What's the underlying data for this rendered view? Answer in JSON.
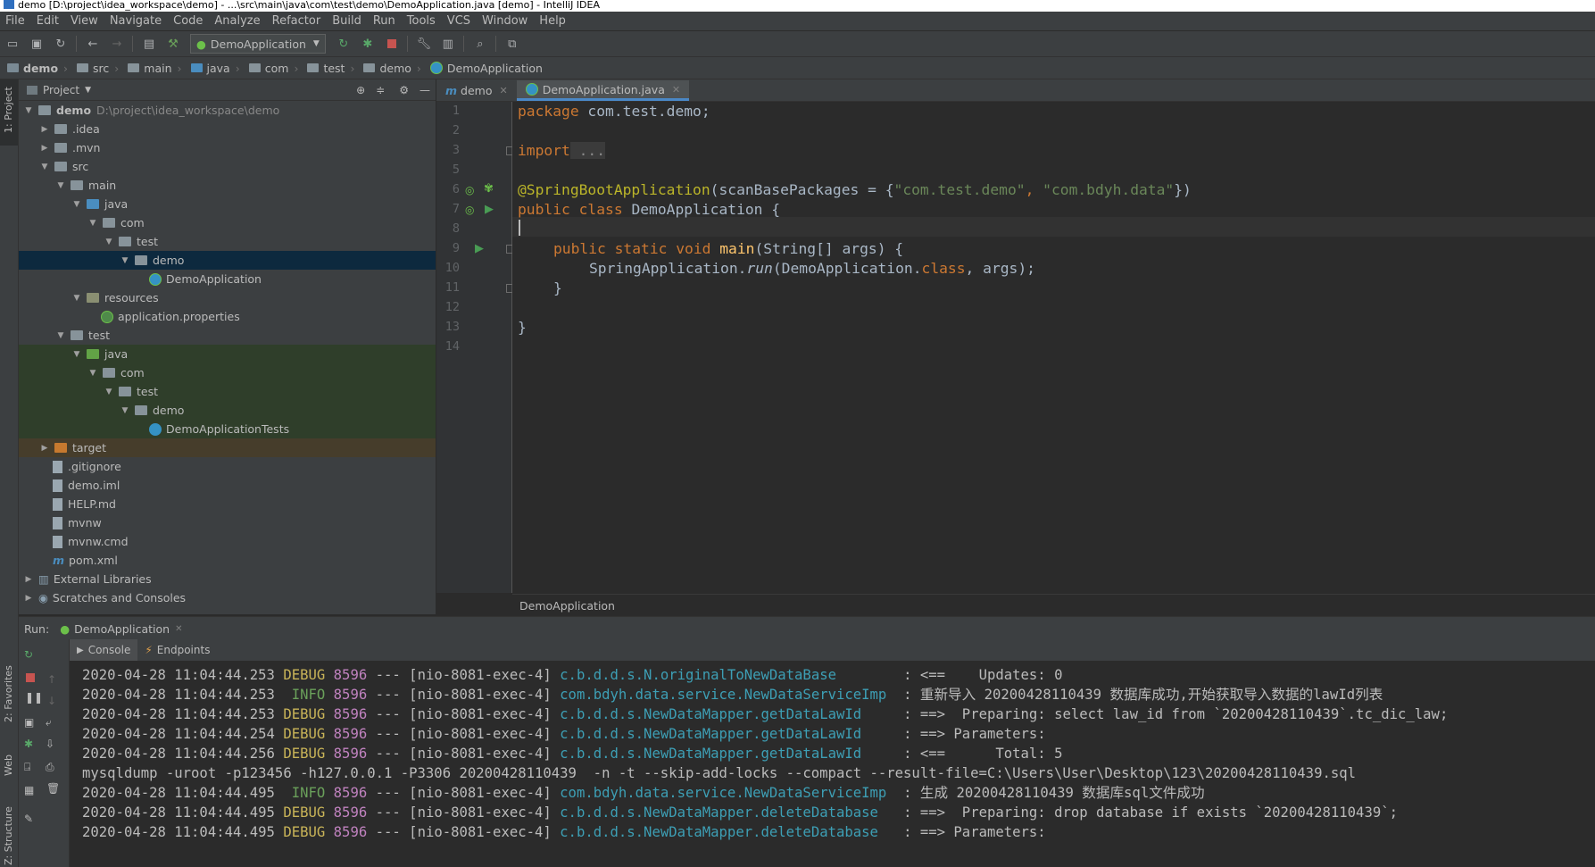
{
  "window": {
    "title": "demo [D:\\project\\idea_workspace\\demo] - ...\\src\\main\\java\\com\\test\\demo\\DemoApplication.java [demo] - IntelliJ IDEA"
  },
  "menu": [
    "File",
    "Edit",
    "View",
    "Navigate",
    "Code",
    "Analyze",
    "Refactor",
    "Build",
    "Run",
    "Tools",
    "VCS",
    "Window",
    "Help"
  ],
  "toolbar": {
    "run_config": "DemoApplication"
  },
  "breadcrumb": [
    "demo",
    "src",
    "main",
    "java",
    "com",
    "test",
    "demo",
    "DemoApplication"
  ],
  "left_strip": {
    "project": "1: Project",
    "favorites": "2: Favorites",
    "web": "Web",
    "structure": "Z: Structure"
  },
  "project_panel": {
    "title": "Project",
    "tree": [
      {
        "label": "demo",
        "note": "D:\\project\\idea_workspace\\demo"
      },
      {
        "label": ".idea"
      },
      {
        "label": ".mvn"
      },
      {
        "label": "src"
      },
      {
        "label": "main"
      },
      {
        "label": "java"
      },
      {
        "label": "com"
      },
      {
        "label": "test"
      },
      {
        "label": "demo"
      },
      {
        "label": "DemoApplication"
      },
      {
        "label": "resources"
      },
      {
        "label": "application.properties"
      },
      {
        "label": "test"
      },
      {
        "label": "java"
      },
      {
        "label": "com"
      },
      {
        "label": "test"
      },
      {
        "label": "demo"
      },
      {
        "label": "DemoApplicationTests"
      },
      {
        "label": "target"
      },
      {
        "label": ".gitignore"
      },
      {
        "label": "demo.iml"
      },
      {
        "label": "HELP.md"
      },
      {
        "label": "mvnw"
      },
      {
        "label": "mvnw.cmd"
      },
      {
        "label": "pom.xml"
      },
      {
        "label": "External Libraries"
      },
      {
        "label": "Scratches and Consoles"
      }
    ]
  },
  "editor": {
    "tabs": [
      {
        "label": "demo"
      },
      {
        "label": "DemoApplication.java"
      }
    ],
    "line_numbers": [
      "1",
      "2",
      "3",
      "5",
      "6",
      "7",
      "8",
      "9",
      "10",
      "11",
      "12",
      "13",
      "14"
    ],
    "code": {
      "l1_kw": "package",
      "l1_rest": " com.test.demo;",
      "l3_kw": "import",
      "l3_rest": " ...",
      "l6_anno": "@SpringBootApplication",
      "l6_a": "(scanBasePackages = {",
      "l6_s1": "\"com.test.demo\"",
      "l6_c": ", ",
      "l6_s2": "\"com.bdyh.data\"",
      "l6_e": "})",
      "l7_kw": "public class",
      "l7_rest": " DemoApplication {",
      "l9_kw": "public static void",
      "l9_fn": " main",
      "l9_rest": "(String[] args) {",
      "l10_a": "SpringApplication.",
      "l10_run": "run",
      "l10_b": "(DemoApplication.",
      "l10_kw": "class",
      "l10_c": ", args);",
      "l11": "}",
      "l13": "}"
    },
    "footer": "DemoApplication"
  },
  "run_panel": {
    "label": "Run:",
    "config": "DemoApplication",
    "tabs": [
      "Console",
      "Endpoints"
    ],
    "logs": [
      {
        "ts": "2020-04-28 11:04:44.253",
        "lvl": "DEBUG",
        "pid": "8596",
        "sep": "---",
        "thread": "[nio-8081-exec-4]",
        "cls": "c.b.d.d.s.N.originalToNewDataBase       ",
        "msg": ": <==    Updates: 0"
      },
      {
        "ts": "2020-04-28 11:04:44.253",
        "lvl": " INFO",
        "pid": "8596",
        "sep": "---",
        "thread": "[nio-8081-exec-4]",
        "cls": "com.bdyh.data.service.NewDataServiceImp ",
        "msg": ": 重新导入 20200428110439 数据库成功,开始获取导入数据的lawId列表"
      },
      {
        "ts": "2020-04-28 11:04:44.253",
        "lvl": "DEBUG",
        "pid": "8596",
        "sep": "---",
        "thread": "[nio-8081-exec-4]",
        "cls": "c.b.d.d.s.NewDataMapper.getDataLawId    ",
        "msg": ": ==>  Preparing: select law_id from `20200428110439`.tc_dic_law;"
      },
      {
        "ts": "2020-04-28 11:04:44.254",
        "lvl": "DEBUG",
        "pid": "8596",
        "sep": "---",
        "thread": "[nio-8081-exec-4]",
        "cls": "c.b.d.d.s.NewDataMapper.getDataLawId    ",
        "msg": ": ==> Parameters: "
      },
      {
        "ts": "2020-04-28 11:04:44.256",
        "lvl": "DEBUG",
        "pid": "8596",
        "sep": "---",
        "thread": "[nio-8081-exec-4]",
        "cls": "c.b.d.d.s.NewDataMapper.getDataLawId    ",
        "msg": ": <==      Total: 5"
      },
      {
        "plain": "mysqldump -uroot -p123456 -h127.0.0.1 -P3306 20200428110439  -n -t --skip-add-locks --compact --result-file=C:\\Users\\User\\Desktop\\123\\20200428110439.sql"
      },
      {
        "ts": "2020-04-28 11:04:44.495",
        "lvl": " INFO",
        "pid": "8596",
        "sep": "---",
        "thread": "[nio-8081-exec-4]",
        "cls": "com.bdyh.data.service.NewDataServiceImp ",
        "msg": ": 生成 20200428110439 数据库sql文件成功"
      },
      {
        "ts": "2020-04-28 11:04:44.495",
        "lvl": "DEBUG",
        "pid": "8596",
        "sep": "---",
        "thread": "[nio-8081-exec-4]",
        "cls": "c.b.d.d.s.NewDataMapper.deleteDatabase  ",
        "msg": ": ==>  Preparing: drop database if exists `20200428110439`;"
      },
      {
        "ts": "2020-04-28 11:04:44.495",
        "lvl": "DEBUG",
        "pid": "8596",
        "sep": "---",
        "thread": "[nio-8081-exec-4]",
        "cls": "c.b.d.d.s.NewDataMapper.deleteDatabase  ",
        "msg": ": ==> Parameters: "
      }
    ]
  }
}
